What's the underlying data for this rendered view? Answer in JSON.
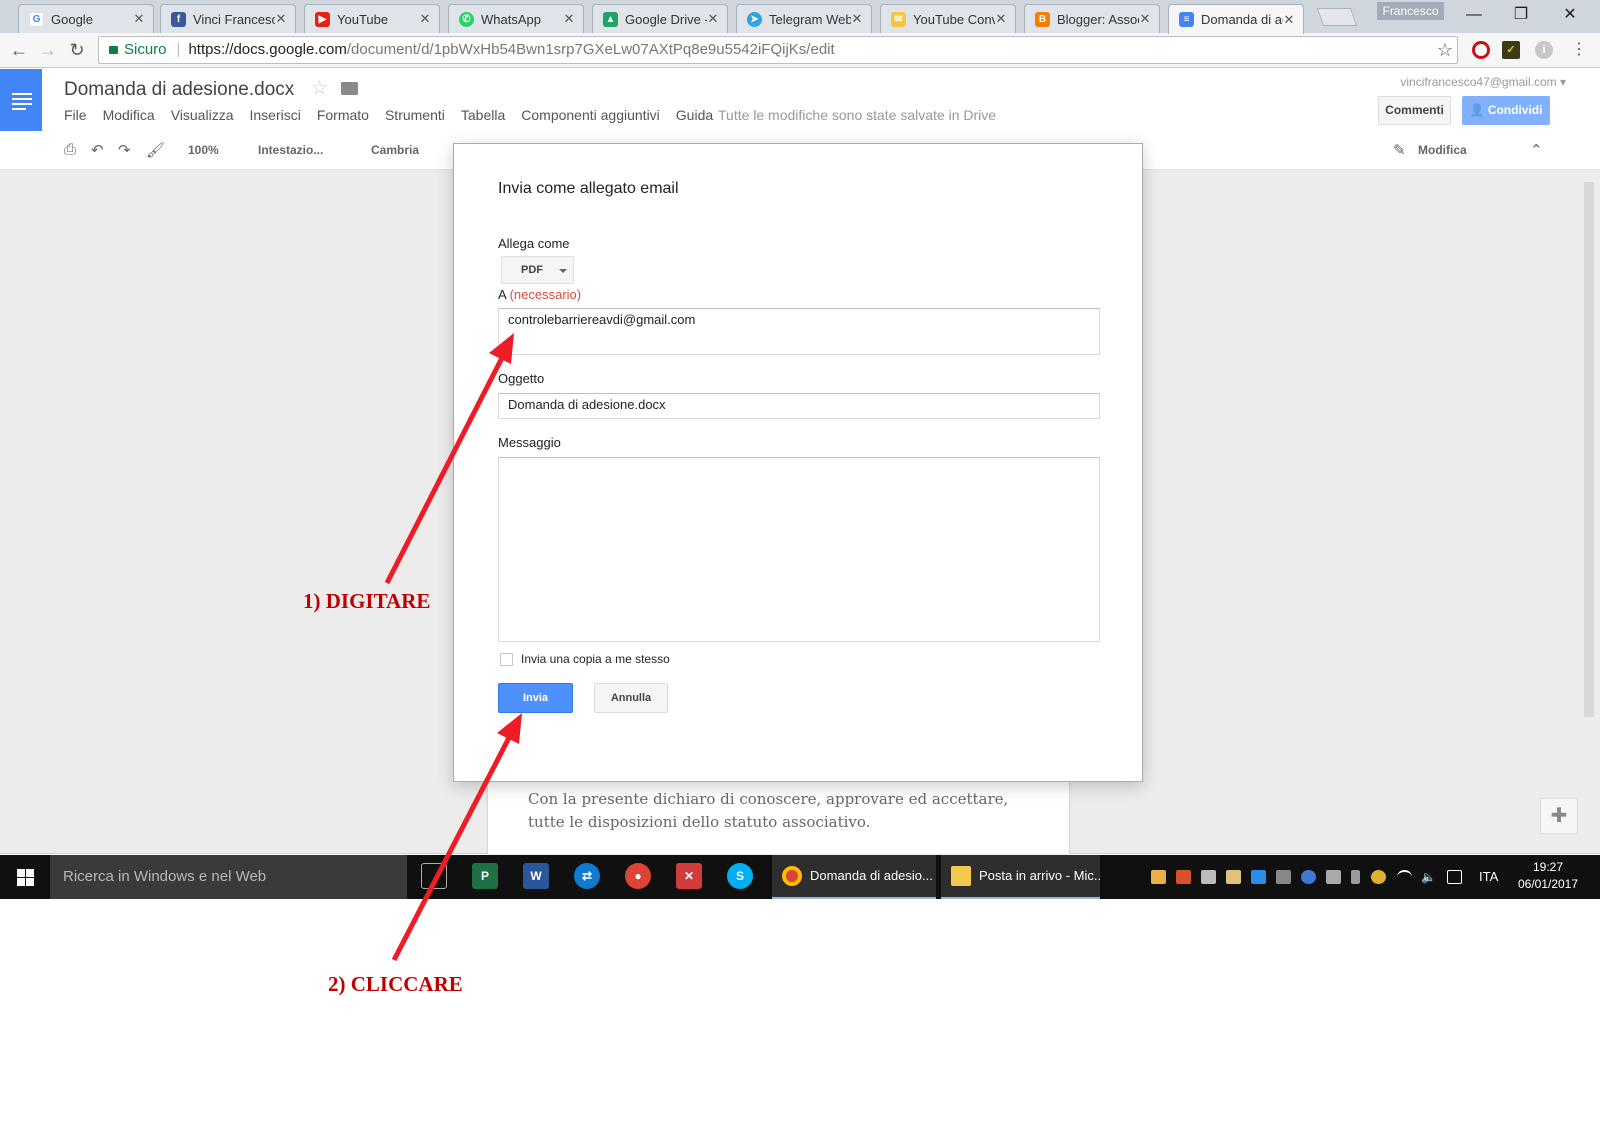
{
  "browser": {
    "tabs": [
      {
        "title": "Google",
        "icon": "google-icon",
        "color": "#ffffff"
      },
      {
        "title": "Vinci Francesco",
        "icon": "facebook-icon",
        "color": "#3b5998"
      },
      {
        "title": "YouTube",
        "icon": "youtube-icon",
        "color": "#e62117"
      },
      {
        "title": "WhatsApp",
        "icon": "whatsapp-icon",
        "color": "#25d366"
      },
      {
        "title": "Google Drive -",
        "icon": "google-drive-icon",
        "color": "#1fa463"
      },
      {
        "title": "Telegram Web",
        "icon": "telegram-icon",
        "color": "#2ca5e0"
      },
      {
        "title": "YouTube Conv",
        "icon": "youtube-converter-icon",
        "color": "#f5c542"
      },
      {
        "title": "Blogger: Assoc",
        "icon": "blogger-icon",
        "color": "#f57d00"
      },
      {
        "title": "Domanda di ad",
        "icon": "google-docs-icon",
        "color": "#4285f4"
      }
    ],
    "active_tab": 8,
    "profile_name": "Francesco",
    "secure_label": "Sicuro",
    "url_host": "https://docs.google.com",
    "url_path": "/document/d/1pbWxHb54Bwn1srp7GXeLw07AXtPq8e9u5542iFQijKs/edit"
  },
  "docs": {
    "title": "Domanda di adesione.docx",
    "menu": [
      "File",
      "Modifica",
      "Visualizza",
      "Inserisci",
      "Formato",
      "Strumenti",
      "Tabella",
      "Componenti aggiuntivi",
      "Guida"
    ],
    "saved_status": "Tutte le modifiche sono state salvate in Drive",
    "account": "vincifrancesco47@gmail.com",
    "comments_label": "Commenti",
    "share_label": "Condividi",
    "toolbar": {
      "zoom": "100%",
      "style": "Intestazio...",
      "font": "Cambria",
      "mode": "Modifica"
    },
    "body_text": "Con la presente dichiaro di conoscere, approvare ed accettare, tutte le disposizioni dello statuto associativo."
  },
  "dialog": {
    "title": "Invia come allegato email",
    "attach_label": "Allega come",
    "attach_value": "PDF",
    "to_label": "A",
    "to_required": "(necessario)",
    "to_value": "controlebarriereavdi@gmail.com",
    "subject_label": "Oggetto",
    "subject_value": "Domanda di adesione.docx",
    "message_label": "Messaggio",
    "message_value": "",
    "copy_label": "Invia una copia a me stesso",
    "copy_checked": false,
    "send_label": "Invia",
    "cancel_label": "Annulla"
  },
  "taskbar": {
    "search_placeholder": "Ricerca in Windows e nel Web",
    "tasks": [
      {
        "label": "Domanda di adesio...",
        "icon": "chrome-icon"
      },
      {
        "label": "Posta in arrivo - Mic...",
        "icon": "outlook-icon"
      }
    ],
    "language": "ITA",
    "time": "19:27",
    "date": "06/01/2017"
  },
  "annotations": {
    "step1": "1) DIGITARE",
    "step2": "2) CLICCARE",
    "color": "#c00000"
  }
}
